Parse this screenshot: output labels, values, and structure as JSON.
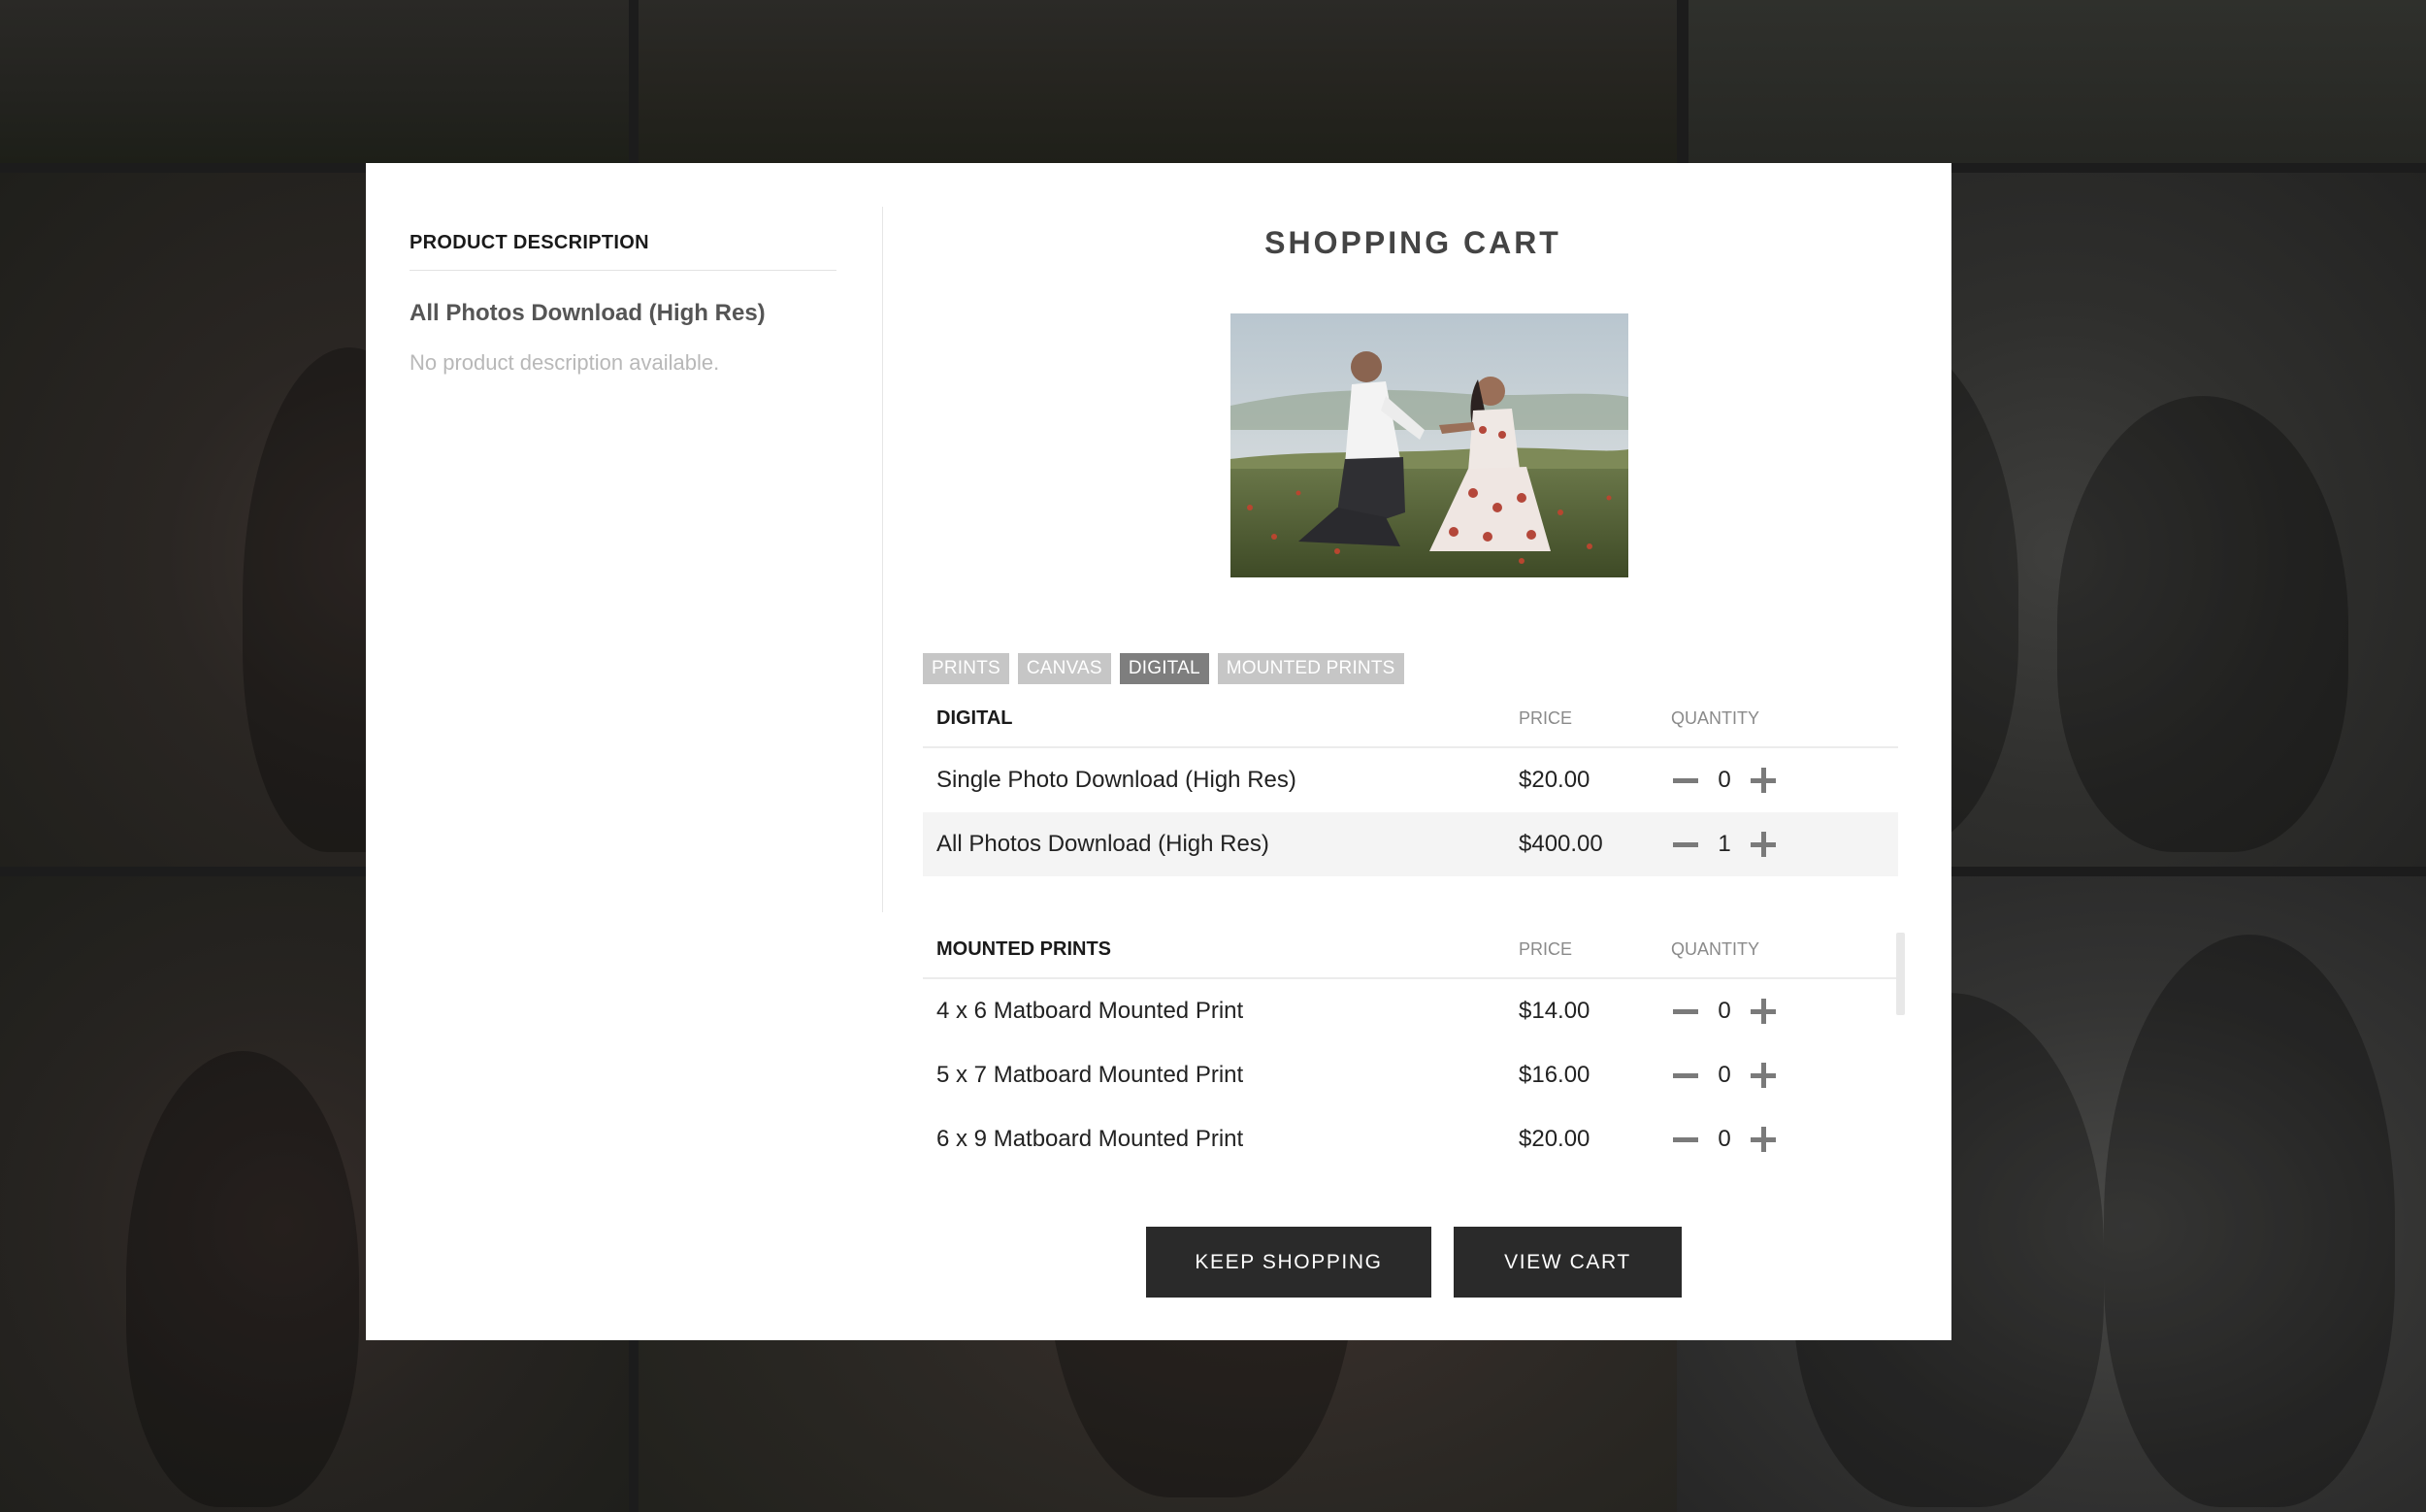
{
  "background": {
    "color": "#1c1c1c"
  },
  "left_panel": {
    "heading": "PRODUCT DESCRIPTION",
    "product_name": "All Photos Download (High Res)",
    "description": "No product description available."
  },
  "cart": {
    "title": "SHOPPING CART",
    "tabs": [
      {
        "label": "PRINTS",
        "active": false
      },
      {
        "label": "CANVAS",
        "active": false
      },
      {
        "label": "DIGITAL",
        "active": true
      },
      {
        "label": "MOUNTED PRINTS",
        "active": false
      }
    ],
    "sections": [
      {
        "name": "DIGITAL",
        "price_header": "PRICE",
        "quantity_header": "QUANTITY",
        "items": [
          {
            "name": "Single Photo Download (High Res)",
            "price": "$20.00",
            "quantity": "0",
            "highlighted": false
          },
          {
            "name": "All Photos Download (High Res)",
            "price": "$400.00",
            "quantity": "1",
            "highlighted": true
          }
        ]
      },
      {
        "name": "MOUNTED PRINTS",
        "price_header": "PRICE",
        "quantity_header": "QUANTITY",
        "items": [
          {
            "name": "4 x 6 Matboard Mounted Print",
            "price": "$14.00",
            "quantity": "0",
            "highlighted": false
          },
          {
            "name": "5 x 7 Matboard Mounted Print",
            "price": "$16.00",
            "quantity": "0",
            "highlighted": false
          },
          {
            "name": "6 x 9 Matboard Mounted Print",
            "price": "$20.00",
            "quantity": "0",
            "highlighted": false
          }
        ]
      }
    ],
    "buttons": {
      "keep_shopping": "KEEP SHOPPING",
      "view_cart": "VIEW CART"
    }
  },
  "colors": {
    "button_bg": "#2a2a2a",
    "tab_inactive": "#c6c6c6",
    "tab_active": "#7e7e7e",
    "row_highlight": "#f4f4f4"
  },
  "icons": {
    "decrement": "minus-icon",
    "increment": "plus-icon"
  }
}
